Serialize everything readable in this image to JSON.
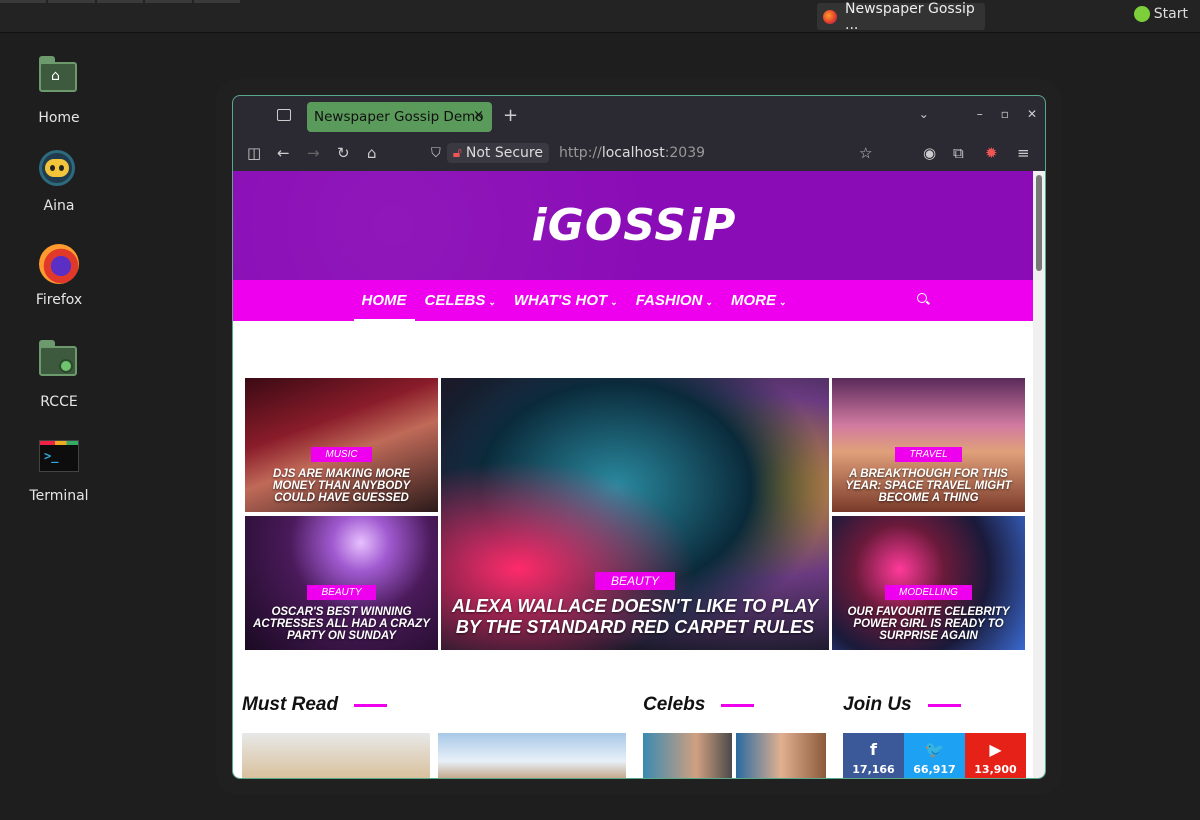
{
  "panel": {
    "task_title": "Newspaper Gossip ...",
    "start_label": "Start"
  },
  "desktop": {
    "icons": [
      {
        "label": "Home"
      },
      {
        "label": "Aina"
      },
      {
        "label": "Firefox"
      },
      {
        "label": "RCCE"
      },
      {
        "label": "Terminal"
      }
    ]
  },
  "browser": {
    "tab_title": "Newspaper Gossip Demo",
    "new_tab": "+",
    "tab_close": "×",
    "not_secure": "Not Secure",
    "url_prefix": "http://",
    "url_host": "localhost",
    "url_port": ":2039"
  },
  "site": {
    "logo": "iGOSSiP",
    "nav": [
      {
        "label": "HOME",
        "dropdown": false
      },
      {
        "label": "CELEBS",
        "dropdown": true
      },
      {
        "label": "WHAT'S HOT",
        "dropdown": true
      },
      {
        "label": "FASHION",
        "dropdown": true
      },
      {
        "label": "MORE",
        "dropdown": true
      }
    ],
    "hero": [
      {
        "category": "MUSIC",
        "title": "DJS ARE MAKING MORE MONEY THAN ANYBODY COULD HAVE GUESSED"
      },
      {
        "category": "BEAUTY",
        "title": "OSCAR'S BEST WINNING ACTRESSES ALL HAD A CRAZY PARTY ON SUNDAY"
      },
      {
        "category": "BEAUTY",
        "title": "ALEXA WALLACE DOESN'T LIKE TO PLAY BY THE STANDARD RED CARPET RULES"
      },
      {
        "category": "TRAVEL",
        "title": "A BREAKTHOUGH FOR THIS YEAR: SPACE TRAVEL MIGHT BECOME A THING"
      },
      {
        "category": "MODELLING",
        "title": "OUR FAVOURITE CELEBRITY POWER GIRL IS READY TO SURPRISE AGAIN"
      }
    ],
    "sections": {
      "must_read": "Must Read",
      "celebs": "Celebs",
      "join_us": "Join Us"
    },
    "social": [
      {
        "glyph": "f",
        "count": "17,166",
        "color": "#3b5998"
      },
      {
        "glyph": "🐦",
        "count": "66,917",
        "color": "#1da1f2"
      },
      {
        "glyph": "▶",
        "count": "13,900",
        "color": "#e62117"
      }
    ]
  }
}
